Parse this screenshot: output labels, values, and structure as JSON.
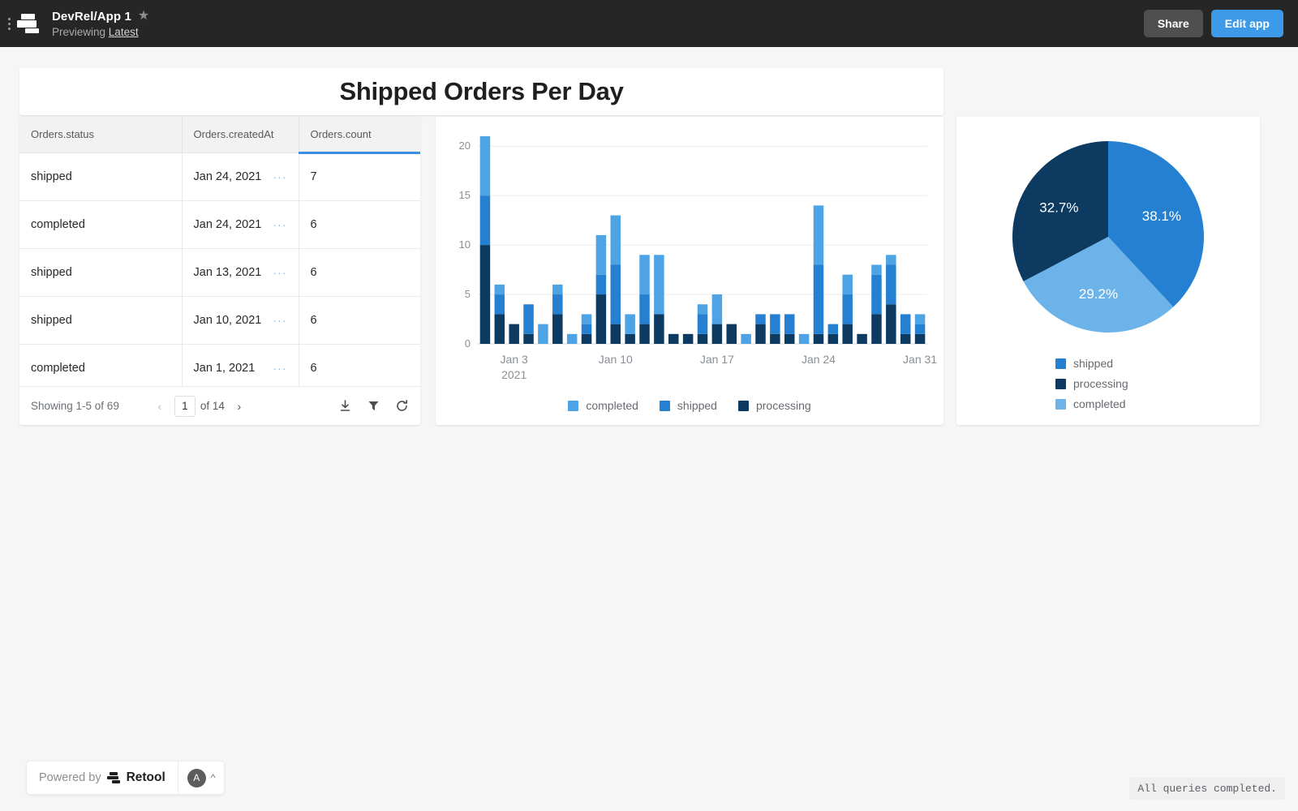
{
  "topbar": {
    "logo_icon": "retool-logo-icon",
    "app_name": "DevRel/App 1",
    "star_icon": "star-icon",
    "previewing_prefix": "Previewing",
    "previewing_target": "Latest",
    "share_label": "Share",
    "edit_label": "Edit app"
  },
  "header": {
    "title": "Shipped Orders Per Day"
  },
  "table": {
    "columns": [
      "Orders.status",
      "Orders.createdAt",
      "Orders.count"
    ],
    "sorted_column": "Orders.count",
    "rows": [
      {
        "status": "shipped",
        "createdAt": "Jan 24, 2021",
        "count": "7"
      },
      {
        "status": "completed",
        "createdAt": "Jan 24, 2021",
        "count": "6"
      },
      {
        "status": "shipped",
        "createdAt": "Jan 13, 2021",
        "count": "6"
      },
      {
        "status": "shipped",
        "createdAt": "Jan 10, 2021",
        "count": "6"
      },
      {
        "status": "completed",
        "createdAt": "Jan 1, 2021",
        "count": "6"
      }
    ],
    "cell_overflow_indicator": "···",
    "footer": {
      "showing": "Showing 1-5 of 69",
      "prev_icon": "chevron-left-icon",
      "page_value": "1",
      "of_pages": "of 14",
      "next_icon": "chevron-right-icon",
      "download_icon": "download-icon",
      "filter_icon": "filter-icon",
      "refresh_icon": "refresh-icon"
    }
  },
  "colors": {
    "completed": "#4ea3e4",
    "shipped": "#2680d2",
    "processing": "#0c3a61",
    "accent": "#3d9ae8",
    "grid": "#ececec",
    "axis_text": "#8a8f94"
  },
  "chart_data": [
    {
      "type": "bar",
      "id": "shipped-orders-per-day-bar",
      "stacked": true,
      "title": "",
      "xlabel": "",
      "ylabel": "",
      "ylim": [
        0,
        21
      ],
      "yticks": [
        0,
        5,
        10,
        15,
        20
      ],
      "grid": true,
      "legend_position": "bottom",
      "x_tick_labels": [
        "Jan 3\n2021",
        "Jan 10",
        "Jan 17",
        "Jan 24",
        "Jan 31"
      ],
      "x_tick_indices": [
        2,
        9,
        16,
        23,
        30
      ],
      "x": [
        "Jan 1",
        "Jan 2",
        "Jan 3",
        "Jan 4",
        "Jan 5",
        "Jan 6",
        "Jan 7",
        "Jan 8",
        "Jan 9",
        "Jan 10",
        "Jan 11",
        "Jan 12",
        "Jan 13",
        "Jan 14",
        "Jan 15",
        "Jan 16",
        "Jan 17",
        "Jan 18",
        "Jan 19",
        "Jan 20",
        "Jan 21",
        "Jan 22",
        "Jan 23",
        "Jan 24",
        "Jan 25",
        "Jan 26",
        "Jan 27",
        "Jan 28",
        "Jan 29",
        "Jan 30",
        "Jan 31"
      ],
      "series": [
        {
          "name": "processing",
          "color": "#0c3a61",
          "values": [
            10,
            3,
            2,
            1,
            0,
            3,
            0,
            1,
            5,
            2,
            1,
            2,
            3,
            1,
            1,
            1,
            2,
            2,
            0,
            2,
            1,
            1,
            0,
            1,
            1,
            2,
            1,
            3,
            4,
            1,
            1
          ]
        },
        {
          "name": "shipped",
          "color": "#2680d2",
          "values": [
            5,
            2,
            0,
            3,
            0,
            2,
            0,
            1,
            2,
            6,
            0,
            3,
            0,
            0,
            0,
            2,
            0,
            0,
            0,
            1,
            2,
            2,
            0,
            7,
            1,
            3,
            0,
            4,
            4,
            2,
            1
          ]
        },
        {
          "name": "completed",
          "color": "#4ea3e4",
          "values": [
            6,
            1,
            0,
            0,
            2,
            1,
            1,
            1,
            4,
            5,
            2,
            4,
            6,
            0,
            0,
            1,
            3,
            0,
            1,
            0,
            0,
            0,
            1,
            6,
            0,
            2,
            0,
            1,
            1,
            0,
            1
          ]
        }
      ],
      "legend": [
        {
          "label": "completed",
          "color": "#4ea3e4"
        },
        {
          "label": "shipped",
          "color": "#2680d2"
        },
        {
          "label": "processing",
          "color": "#0c3a61"
        }
      ]
    },
    {
      "type": "pie",
      "id": "orders-by-status-pie",
      "title": "",
      "legend_position": "bottom",
      "slices": [
        {
          "label": "shipped",
          "percent": 38.1,
          "display": "38.1%",
          "color": "#2680d2"
        },
        {
          "label": "completed",
          "percent": 29.2,
          "display": "29.2%",
          "color": "#6cb3ea"
        },
        {
          "label": "processing",
          "percent": 32.7,
          "display": "32.7%",
          "color": "#0c3a61"
        }
      ],
      "legend": [
        {
          "label": "shipped",
          "color": "#2680d2"
        },
        {
          "label": "processing",
          "color": "#0c3a61"
        },
        {
          "label": "completed",
          "color": "#6cb3ea"
        }
      ]
    }
  ],
  "footer": {
    "powered_prefix": "Powered by",
    "powered_brand": "Retool",
    "avatar_initial": "A",
    "collapse_icon": "chevron-up-icon",
    "queries_status": "All queries completed."
  }
}
